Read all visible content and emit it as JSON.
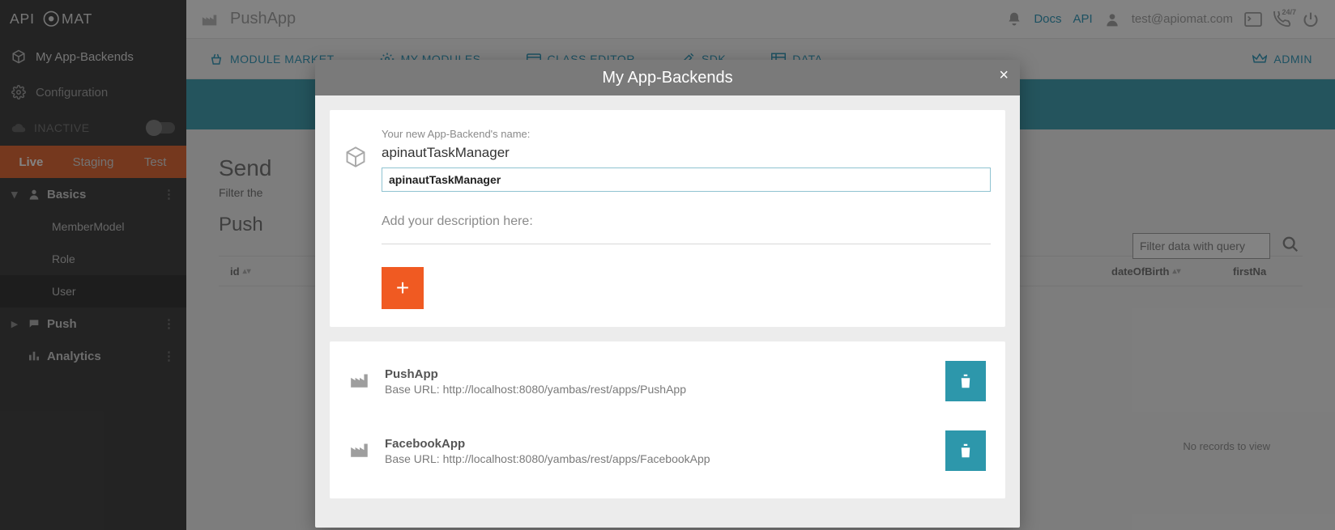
{
  "header": {
    "app_name": "PushApp",
    "docs": "Docs",
    "api": "API",
    "user_email": "test@apiomat.com"
  },
  "tabs": {
    "module_market": "MODULE MARKET",
    "my_modules": "MY MODULES",
    "class_editor": "CLASS EDITOR",
    "sdk": "SDK",
    "data": "DATA",
    "admin": "ADMIN"
  },
  "sidebar": {
    "backends": "My App-Backends",
    "configuration": "Configuration",
    "inactive": "INACTIVE",
    "env": {
      "live": "Live",
      "staging": "Staging",
      "test": "Test"
    },
    "tree": {
      "basics": "Basics",
      "membermodel": "MemberModel",
      "role": "Role",
      "user": "User",
      "push": "Push",
      "analytics": "Analytics"
    }
  },
  "main": {
    "send_heading": "Send",
    "filter_sub": "Filter the",
    "push_heading": "Push",
    "filter_placeholder": "Filter data with query",
    "col_id": "id",
    "col_dob": "dateOfBirth",
    "col_fn": "firstNa",
    "no_records": "No records to view"
  },
  "modal": {
    "title": "My App-Backends",
    "new_label": "Your new App-Backend's name:",
    "new_name_display": "apinautTaskManager",
    "new_name_value": "apinautTaskManager",
    "desc_label": "Add your description here:",
    "backends": [
      {
        "name": "PushApp",
        "url": "Base URL: http://localhost:8080/yambas/rest/apps/PushApp"
      },
      {
        "name": "FacebookApp",
        "url": "Base URL: http://localhost:8080/yambas/rest/apps/FacebookApp"
      }
    ]
  }
}
